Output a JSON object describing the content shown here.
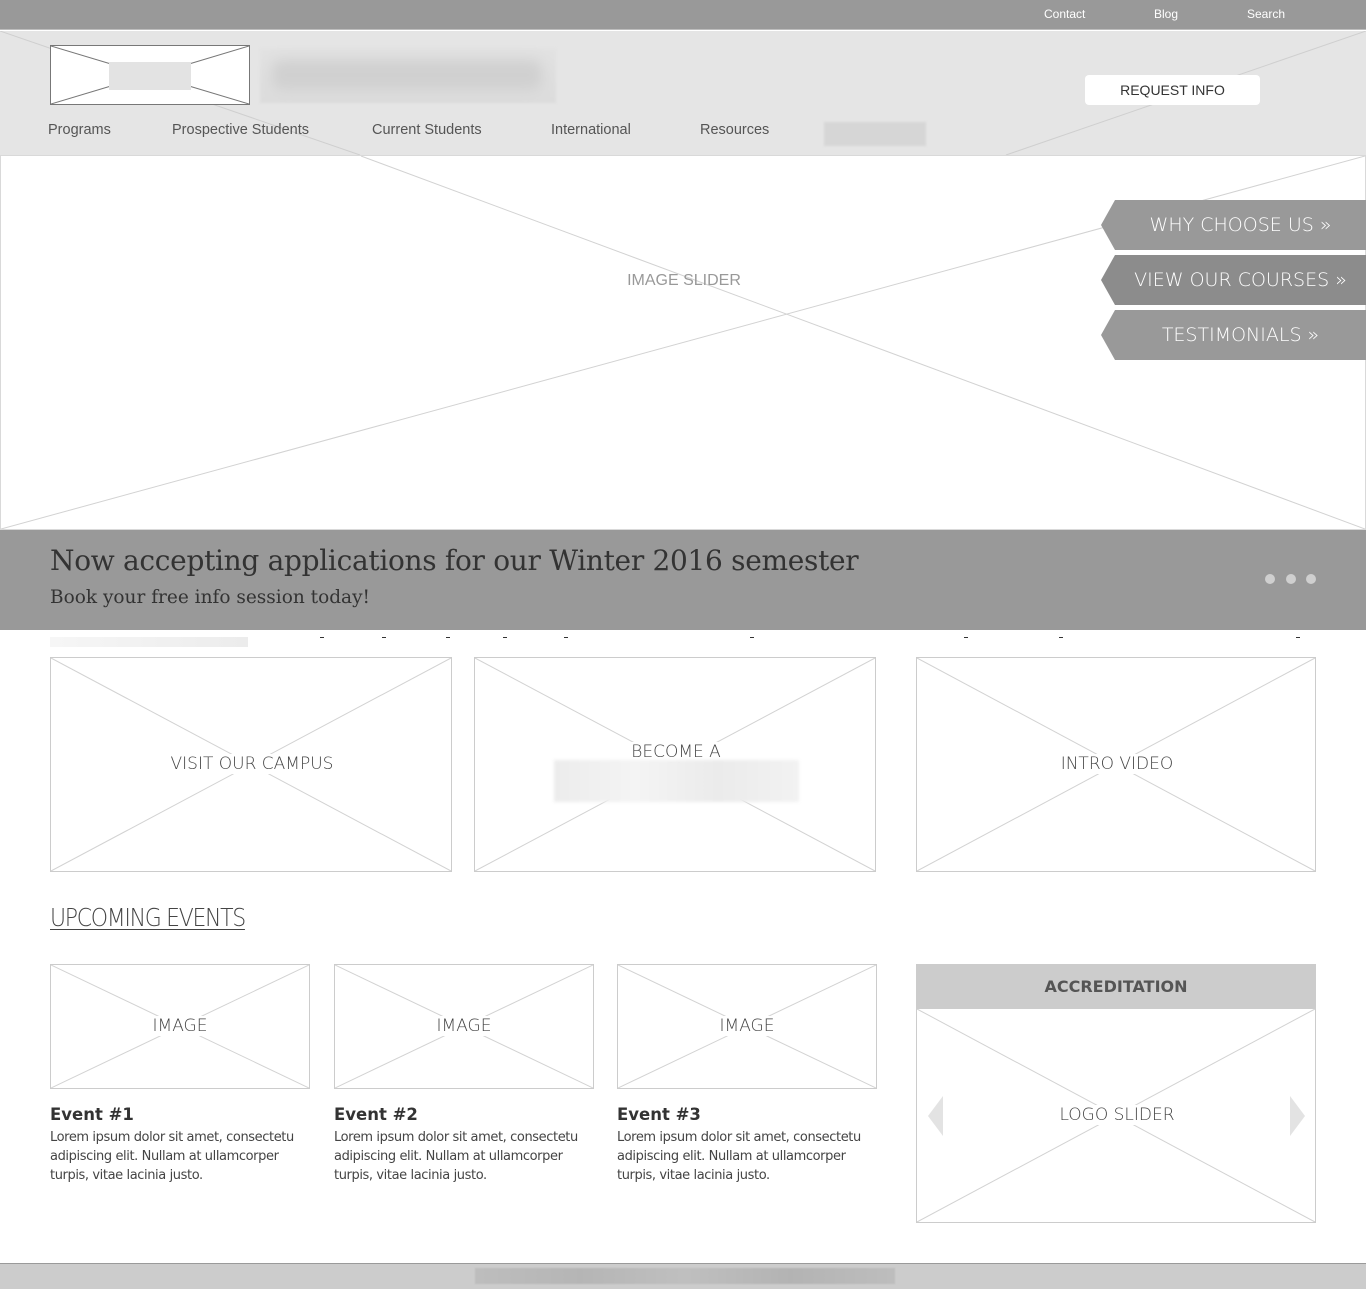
{
  "topbar": {
    "links": [
      "Contact",
      "Blog",
      "Search"
    ]
  },
  "header": {
    "request_info": "REQUEST INFO",
    "nav": [
      "Programs",
      "Prospective Students",
      "Current Students",
      "International",
      "Resources"
    ]
  },
  "hero": {
    "label": "IMAGE SLIDER",
    "tabs": [
      "WHY CHOOSE US »",
      "VIEW OUR COURSES »",
      "TESTIMONIALS »"
    ]
  },
  "banner": {
    "headline": "Now accepting applications for our Winter 2016 semester",
    "subline": "Book your free info session today!",
    "slide_count": 3
  },
  "cta": {
    "visit": "VISIT OUR CAMPUS",
    "become": "BECOME A",
    "video": "INTRO VIDEO"
  },
  "events": {
    "heading": "UPCOMING EVENTS",
    "items": [
      {
        "image": "IMAGE",
        "title": "Event #1",
        "desc": "Lorem ipsum dolor sit amet, consectetu adipiscing elit. Nullam at ullamcorper turpis, vitae lacinia justo."
      },
      {
        "image": "IMAGE",
        "title": "Event #2",
        "desc": "Lorem ipsum dolor sit amet, consectetu adipiscing elit. Nullam at ullamcorper turpis, vitae lacinia justo."
      },
      {
        "image": "IMAGE",
        "title": "Event #3",
        "desc": "Lorem ipsum dolor sit amet, consectetu adipiscing elit. Nullam at ullamcorper turpis, vitae lacinia justo."
      }
    ]
  },
  "accreditation": {
    "heading": "ACCREDITATION",
    "label": "LOGO SLIDER"
  },
  "colors": {
    "topbar": "#999999",
    "header_bg": "#e5e5e5",
    "tab_bg": "#999999",
    "tab_active_bg": "#8c8c8c",
    "banner_bg": "#999999",
    "footer_bg": "#cccccc"
  }
}
